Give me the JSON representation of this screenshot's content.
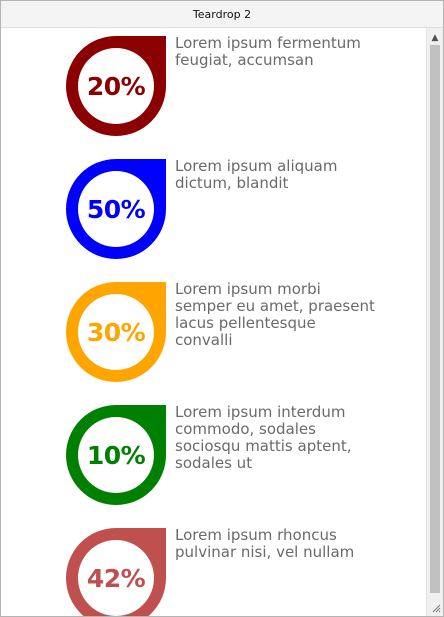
{
  "window": {
    "title": "Teardrop 2"
  },
  "items": [
    {
      "percent": "20%",
      "color": "#8b0000",
      "text": "Lorem ipsum fermentum feugiat, accumsan"
    },
    {
      "percent": "50%",
      "color": "#0000ff",
      "text": "Lorem ipsum aliquam dictum, blandit"
    },
    {
      "percent": "30%",
      "color": "#ffa500",
      "text": "Lorem ipsum morbi semper eu amet, praesent lacus pellentesque convalli"
    },
    {
      "percent": "10%",
      "color": "#008000",
      "text": "Lorem ipsum interdum commodo, sodales sociosqu mattis aptent, sodales ut"
    },
    {
      "percent": "42%",
      "color": "#c0504d",
      "text": "Lorem ipsum rhoncus pulvinar nisi, vel nullam"
    }
  ],
  "scrollbar": {
    "up_icon": "chevron-up-icon",
    "up_glyph": "▲",
    "grip_icon": "resize-grip-icon"
  }
}
